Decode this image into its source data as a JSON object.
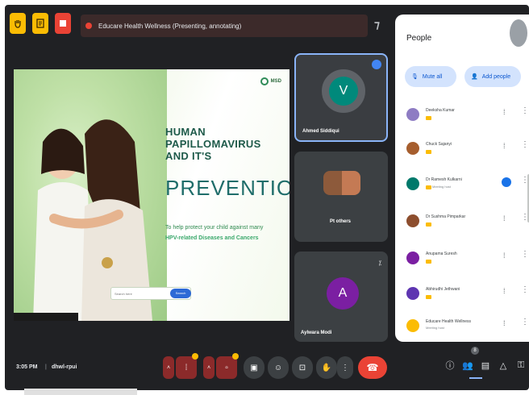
{
  "meeting": {
    "title": "Educare Health Wellness (Presenting, annotating)",
    "time": "3:05 PM",
    "separator": "|",
    "code": "dhwl-rpui"
  },
  "slide": {
    "headline_1": "HUMAN",
    "headline_2": "PAPILLOMAVIRUS",
    "headline_3": "AND IT'S",
    "prevention": "PREVENTION",
    "sub_1": "To help protect your child against many",
    "sub_2": "HPV-related Diseases and Cancers",
    "logo_text": "MSD",
    "search_placeholder": "Search here",
    "search_button": "Search"
  },
  "tiles": [
    {
      "name": "Ahmed Siddiqui",
      "avatar_letter": "V"
    },
    {
      "name": "Pt others"
    },
    {
      "name": "Aylwara Modi",
      "avatar_letter": "A"
    }
  ],
  "people": {
    "title": "People",
    "mute_all": "Mute all",
    "add_people": "Add people",
    "list": [
      {
        "name": "Deeksha Kumar",
        "sub": "",
        "color": "#8e7cc3"
      },
      {
        "name": "Chuck Sajanyi",
        "sub": "",
        "color": "#a65e2e"
      },
      {
        "name": "Dr Ramesh Kulkarni",
        "sub": "Meeting host",
        "color": "#00796b"
      },
      {
        "name": "Dr Sushma Pimparkar",
        "sub": "",
        "color": "#8d4e2e"
      },
      {
        "name": "Anupama Suresh",
        "sub": "",
        "color": "#7b1fa2"
      },
      {
        "name": "Abhirudhi Jethwani",
        "sub": "",
        "color": "#5e35b1"
      },
      {
        "name": "Educare Health Wellness",
        "sub": "Meeting host",
        "color": "#fbbc04"
      }
    ]
  },
  "colors": {
    "stage": "#202124",
    "accent": "#8ab4f8",
    "end_call": "#ea4335"
  },
  "icons": {
    "top": [
      "hand-icon",
      "notes-icon",
      "stop-icon"
    ],
    "bottom_right": [
      "info-icon",
      "people-icon",
      "chat-icon",
      "activities-icon",
      "lock-icon"
    ],
    "controls": [
      "mic-icon",
      "camera-icon",
      "captions-icon",
      "emoji-icon",
      "present-icon",
      "raise-hand-icon",
      "more-icon"
    ]
  },
  "participant_count": "8"
}
